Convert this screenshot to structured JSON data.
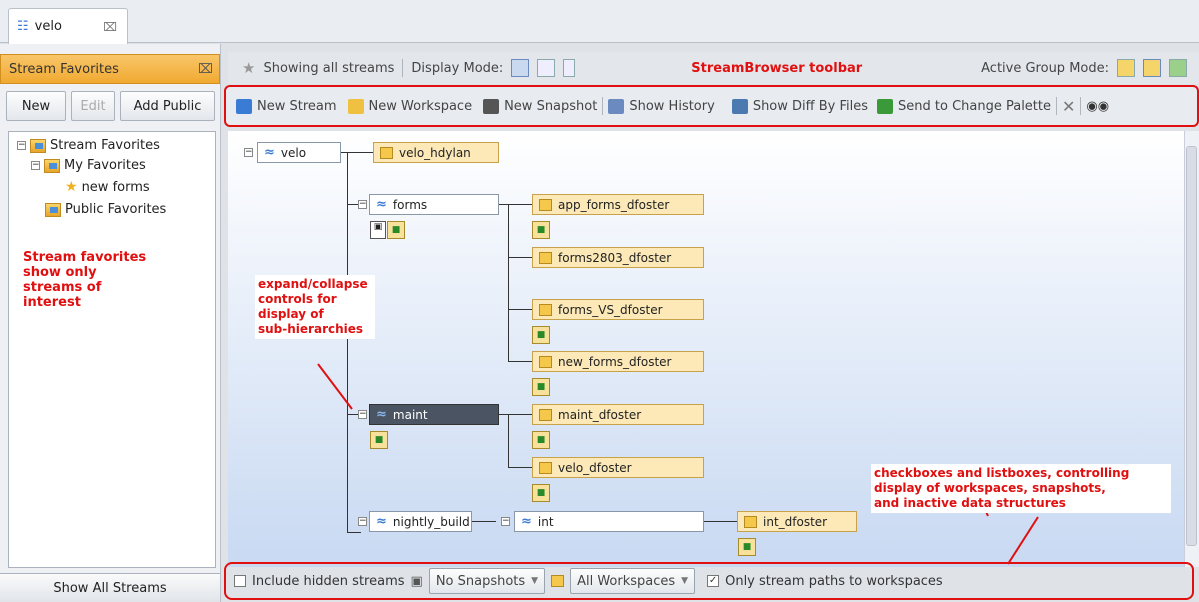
{
  "tab": {
    "title": "velo",
    "close": "⌧"
  },
  "favorites": {
    "header": "Stream Favorites",
    "close": "⌧",
    "buttons": {
      "new": "New",
      "edit": "Edit",
      "add_public": "Add Public"
    },
    "tree": {
      "root": "Stream Favorites",
      "my": "My Favorites",
      "item": "new forms",
      "public": "Public Favorites"
    },
    "note": [
      "Stream favorites",
      "show only",
      "streams of",
      "interest"
    ],
    "show_all": "Show All Streams"
  },
  "toolbar1": {
    "showing": "Showing all streams",
    "display_mode": "Display Mode:",
    "label": "StreamBrowser toolbar",
    "group_mode": "Active Group Mode:"
  },
  "toolbar2": {
    "new_stream": "New Stream",
    "new_workspace": "New Workspace",
    "new_snapshot": "New Snapshot",
    "show_history": "Show History",
    "show_diff": "Show Diff By Files",
    "send_palette": "Send to Change Palette"
  },
  "nodes": {
    "velo": "velo",
    "velo_hdylan": "velo_hdylan",
    "forms": "forms",
    "app_forms": "app_forms_dfoster",
    "forms2803": "forms2803_dfoster",
    "forms_vs": "forms_VS_dfoster",
    "new_forms": "new_forms_dfoster",
    "maint": "maint",
    "maint_df": "maint_dfoster",
    "velo_df": "velo_dfoster",
    "nightly": "nightly_build",
    "int": "int",
    "int_df": "int_dfoster"
  },
  "annotations": {
    "expand": [
      "expand/collapse",
      "controls for",
      "display of",
      "sub-hierarchies"
    ],
    "checkboxes": [
      "checkboxes and listboxes, controlling",
      "display of workspaces, snapshots,",
      "and inactive data structures"
    ]
  },
  "bottombar": {
    "hidden": "Include hidden streams",
    "snapshots": "No Snapshots",
    "workspaces": "All Workspaces",
    "only_paths": "Only stream paths to workspaces"
  }
}
